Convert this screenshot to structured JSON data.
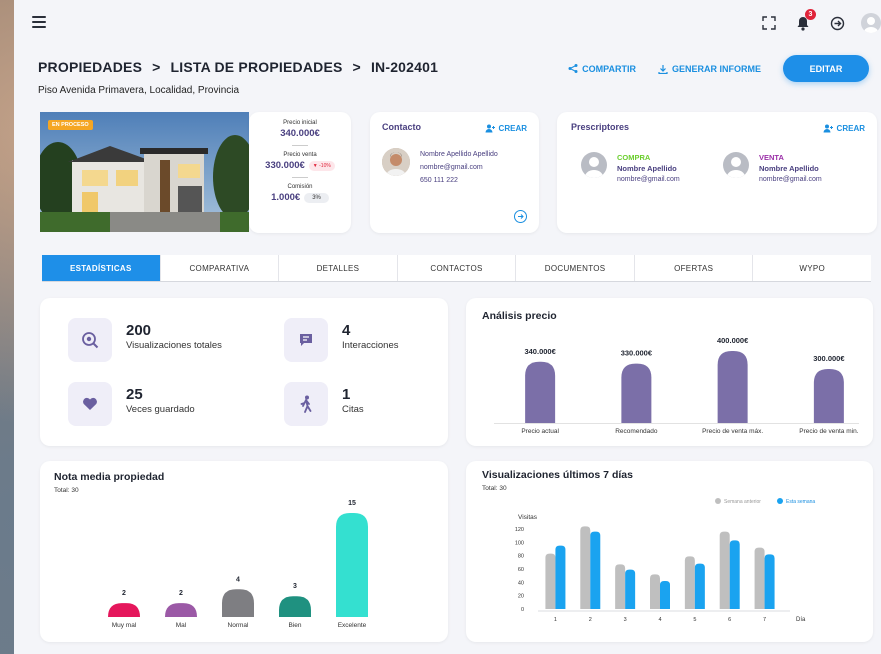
{
  "header": {
    "breadcrumb": [
      "PROPIEDADES",
      "LISTA DE PROPIEDADES",
      "IN-202401"
    ],
    "separator": ">",
    "address": "Piso Avenida Primavera, Localidad, Provincia",
    "share_label": "COMPARTIR",
    "report_label": "GENERAR INFORME",
    "edit_label": "EDITAR"
  },
  "topbar": {
    "notification_count": "3"
  },
  "property": {
    "status": "EN PROCESO",
    "initial_price_label": "Precio inicial",
    "initial_price": "340.000€",
    "sale_price_label": "Precio venta",
    "sale_price": "330.000€",
    "sale_change": "▼ -10%",
    "commission_label": "Comisión",
    "commission": "1.000€",
    "commission_pct": "3%"
  },
  "contact": {
    "title": "Contacto",
    "create_label": "CREAR",
    "name": "Nombre Apellido Apellido",
    "email": "nombre@gmail.com",
    "phone": "650 111 222"
  },
  "prescriptors": {
    "title": "Prescriptores",
    "create_label": "CREAR",
    "items": [
      {
        "role": "COMPRA",
        "name": "Nombre Apellido",
        "email": "nombre@gmail.com",
        "color": "#6ccf2f"
      },
      {
        "role": "VENTA",
        "name": "Nombre Apellido",
        "email": "nombre@gmail.com",
        "color": "#9b2fa8"
      }
    ]
  },
  "tabs": [
    "ESTADÍSTICAS",
    "COMPARATIVA",
    "DETALLES",
    "CONTACTOS",
    "DOCUMENTOS",
    "OFERTAS",
    "WYPO"
  ],
  "active_tab": "ESTADÍSTICAS",
  "stats": [
    {
      "value": "200",
      "label": "Visualizaciones totales",
      "icon": "eye-search-icon"
    },
    {
      "value": "4",
      "label": "Interacciones",
      "icon": "chat-icon"
    },
    {
      "value": "25",
      "label": "Veces guardado",
      "icon": "heart-icon"
    },
    {
      "value": "1",
      "label": "Citas",
      "icon": "walking-icon"
    }
  ],
  "chart_data": [
    {
      "type": "bar",
      "title": "Análisis precio",
      "categories": [
        "Precio actual",
        "Recomendado",
        "Precio de venta máx.",
        "Precio de venta min."
      ],
      "values": [
        340000,
        330000,
        400000,
        300000
      ],
      "data_labels": [
        "340.000€",
        "330.000€",
        "400.000€",
        "300.000€"
      ],
      "color": "#7b6fa8"
    },
    {
      "type": "bar",
      "title": "Nota media propiedad",
      "subtitle": "Total: 30",
      "categories": [
        "Muy mal",
        "Mal",
        "Normal",
        "Bien",
        "Excelente"
      ],
      "values": [
        2,
        2,
        4,
        3,
        15
      ],
      "colors": [
        "#e5175c",
        "#9b59a6",
        "#7e7e82",
        "#1f9180",
        "#34e0d0"
      ]
    },
    {
      "type": "bar",
      "title": "Visualizaciones últimos 7 días",
      "subtitle": "Total: 30",
      "ylabel": "Visitas",
      "xlabel": "Día",
      "categories": [
        "1",
        "2",
        "3",
        "4",
        "5",
        "6",
        "7"
      ],
      "yticks": [
        0,
        20,
        40,
        60,
        80,
        100,
        120
      ],
      "ylim": [
        0,
        120
      ],
      "legend_position": "top-right",
      "series": [
        {
          "name": "Semana anterior",
          "values": [
            83,
            124,
            67,
            52,
            79,
            116,
            92
          ],
          "color": "#bfbfbf"
        },
        {
          "name": "Esta semana",
          "values": [
            95,
            116,
            59,
            42,
            68,
            103,
            82
          ],
          "color": "#1aa3f0"
        }
      ]
    }
  ]
}
